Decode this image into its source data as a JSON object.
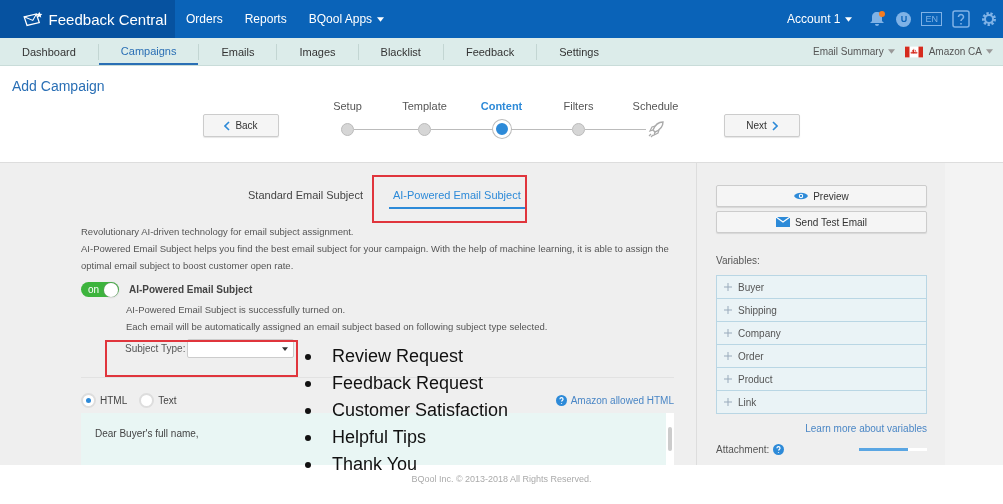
{
  "app": {
    "name": "Feedback Central"
  },
  "top_nav": [
    {
      "label": "Orders",
      "dropdown": false
    },
    {
      "label": "Reports",
      "dropdown": false
    },
    {
      "label": "BQool Apps",
      "dropdown": true
    }
  ],
  "account": {
    "label": "Account 1",
    "notification": true,
    "user_initial": "U",
    "language": "EN"
  },
  "sub_nav": [
    {
      "label": "Dashboard",
      "selected": false
    },
    {
      "label": "Campaigns",
      "selected": true
    },
    {
      "label": "Emails",
      "selected": false
    },
    {
      "label": "Images",
      "selected": false
    },
    {
      "label": "Blacklist",
      "selected": false
    },
    {
      "label": "Feedback",
      "selected": false
    },
    {
      "label": "Settings",
      "selected": false
    }
  ],
  "sub_nav_right": {
    "summary": "Email Summary",
    "marketplace": "Amazon CA"
  },
  "page_title": "Add Campaign",
  "back_button": "Back",
  "next_button": "Next",
  "steps": [
    {
      "label": "Setup",
      "selected": false,
      "kind": "dot"
    },
    {
      "label": "Template",
      "selected": false,
      "kind": "dot"
    },
    {
      "label": "Content",
      "selected": true,
      "kind": "dot"
    },
    {
      "label": "Filters",
      "selected": false,
      "kind": "dot"
    },
    {
      "label": "Schedule",
      "selected": false,
      "kind": "rocket"
    }
  ],
  "subject_tabs": [
    {
      "label": "Standard Email Subject",
      "selected": false
    },
    {
      "label": "AI-Powered Email Subject",
      "selected": true
    }
  ],
  "intro": [
    "Revolutionary AI-driven technology for email subject assignment.",
    "AI-Powered Email Subject helps you find the best email subject for your campaign. With the help of machine learning, it is able to assign the optimal email subject to boost customer open rate."
  ],
  "ai_toggle": {
    "on": true,
    "state_label": "on",
    "label": "AI-Powered Email Subject"
  },
  "ai_status": [
    "AI-Powered Email Subject is successfully turned on.",
    "Each email will be automatically assigned an email subject based on following subject type selected."
  ],
  "subject_type": {
    "label": "Subject Type:"
  },
  "subject_type_options": [
    "Review Request",
    "Feedback Request",
    "Customer Satisfaction",
    "Helpful Tips",
    "Thank You"
  ],
  "format": [
    {
      "label": "HTML",
      "selected": true
    },
    {
      "label": "Text",
      "selected": false
    }
  ],
  "amazon_html_link": "Amazon allowed HTML",
  "editor": {
    "text": "Dear Buyer's full name,"
  },
  "side": {
    "preview": "Preview",
    "send_test": "Send Test Email",
    "variables_label": "Variables:",
    "variables": [
      "Buyer",
      "Shipping",
      "Company",
      "Order",
      "Product",
      "Link"
    ],
    "learn_more": "Learn more about variables",
    "attachment_label": "Attachment:",
    "attachment_progress": {
      "level": 0.72
    }
  },
  "footer": "BQool Inc. © 2013-2018 All Rights Reserved."
}
